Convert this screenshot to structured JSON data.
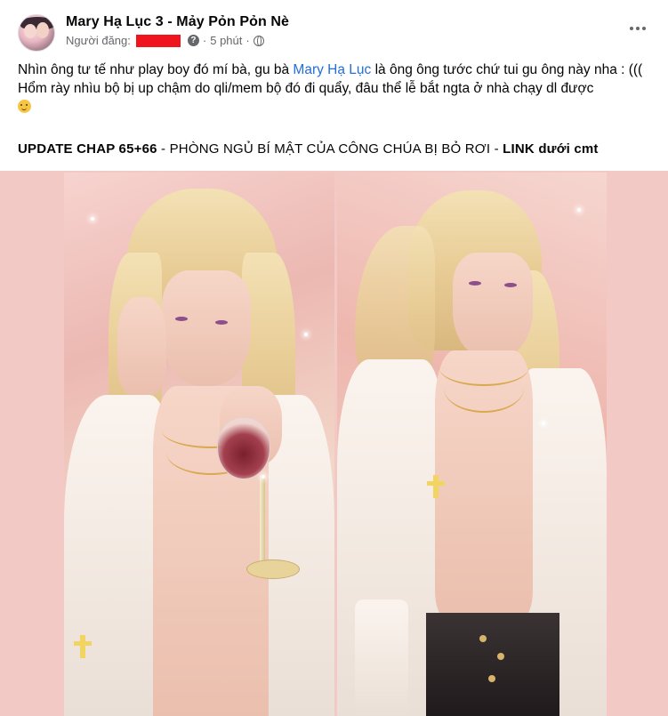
{
  "post": {
    "page_name": "Mary Hạ Lục 3 - Mảy Pỏn Pỏn Nè",
    "meta_prefix": "Người đăng:",
    "time": "5 phút",
    "more_label": "...",
    "body_line1_before": "Nhìn ông tư tế như play boy đó mí bà, gu bà ",
    "body_line1_mention": "Mary Hạ Lục",
    "body_line1_after": " là ông ông tước chứ tui gu ông này nha : (((",
    "body_line2": "Hổm rày nhìu bộ bị up chậm do qli/mem bộ đó đi quẩy, đâu thể lễ bắt ngta ở nhà chạy dl được",
    "update_prefix": "UPDATE CHAP 65+66",
    "update_middle": " - PHÒNG NGỦ BÍ MẬT CỦA CÔNG CHÚA BỊ BỎ RƠI - ",
    "update_link": "LINK dưới cmt"
  },
  "colors": {
    "text": "#050505",
    "muted": "#65676b",
    "mention": "#216fdb",
    "redaction": "#f0141e",
    "media_bg": "#f3c9c6"
  },
  "icons": [
    "avatar",
    "question-icon",
    "globe-icon",
    "more-icon",
    "smile-emoji"
  ]
}
